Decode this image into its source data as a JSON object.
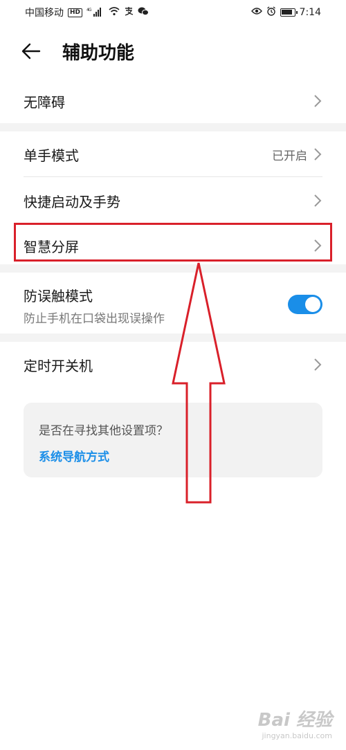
{
  "status_bar": {
    "carrier": "中国移动",
    "hd_badge": "HD",
    "network": "4G",
    "time": "7:14",
    "icons": [
      "hd-icon",
      "signal-icon",
      "wifi-icon",
      "alipay-icon",
      "wechat-icon",
      "eye-icon",
      "alarm-icon",
      "battery-icon"
    ]
  },
  "header": {
    "title": "辅助功能",
    "back_icon": "arrow-left-icon"
  },
  "settings": {
    "accessibility": {
      "label": "无障碍"
    },
    "one_hand_mode": {
      "label": "单手模式",
      "value": "已开启"
    },
    "shortcuts_gestures": {
      "label": "快捷启动及手势"
    },
    "smart_split_screen": {
      "label": "智慧分屏"
    },
    "pocket_mode": {
      "label": "防误触模式",
      "description": "防止手机在口袋出现误操作",
      "enabled": true
    },
    "scheduled_power": {
      "label": "定时开关机"
    }
  },
  "suggestion_card": {
    "question": "是否在寻找其他设置项？",
    "link": "系统导航方式"
  },
  "annotation": {
    "highlight_color": "#d9202a",
    "arrow_color": "#d9202a"
  },
  "colors": {
    "accent": "#1a8ee8",
    "toggle_on": "#1a8ee8"
  },
  "watermark": {
    "main": "Bai 经验",
    "sub": "jingyan.baidu.com"
  }
}
